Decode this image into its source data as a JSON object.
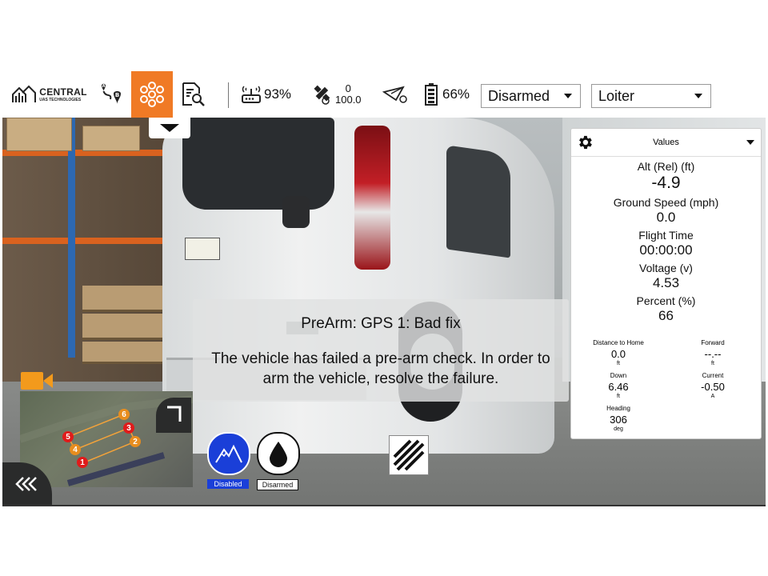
{
  "toolbar": {
    "brand_name": "CENTRAL",
    "brand_sub": "UAS TECHNOLOGIES",
    "telemetry_pct": "93%",
    "gps_sats": "0",
    "gps_hdop": "100.0",
    "battery_pct": "66%",
    "arm_state": "Disarmed",
    "flight_mode": "Loiter",
    "accent": "#f07a25"
  },
  "values_panel": {
    "header": "Values",
    "alt_label": "Alt (Rel) (ft)",
    "alt_value": "-4.9",
    "speed_label": "Ground Speed (mph)",
    "speed_value": "0.0",
    "time_label": "Flight Time",
    "time_value": "00:00:00",
    "voltage_label": "Voltage (v)",
    "voltage_value": "4.53",
    "percent_label": "Percent (%)",
    "percent_value": "66",
    "dist_home_label": "Distance to Home",
    "dist_home_value": "0.0",
    "dist_home_unit": "ft",
    "forward_label": "Forward",
    "forward_value": "--.--",
    "forward_unit": "ft",
    "down_label": "Down",
    "down_value": "6.46",
    "down_unit": "ft",
    "current_label": "Current",
    "current_value": "-0.50",
    "current_unit": "A",
    "heading_label": "Heading",
    "heading_value": "306",
    "heading_unit": "deg"
  },
  "message": {
    "title": "PreArm: GPS 1: Bad fix",
    "body": "The vehicle has failed a pre-arm check. In order to arm the vehicle, resolve the failure."
  },
  "minimap": {
    "waypoints": [
      "1",
      "2",
      "3",
      "4",
      "5",
      "6"
    ]
  },
  "status_buttons": {
    "terrain_label": "Disabled",
    "sprayer_label": "Disarmed"
  }
}
